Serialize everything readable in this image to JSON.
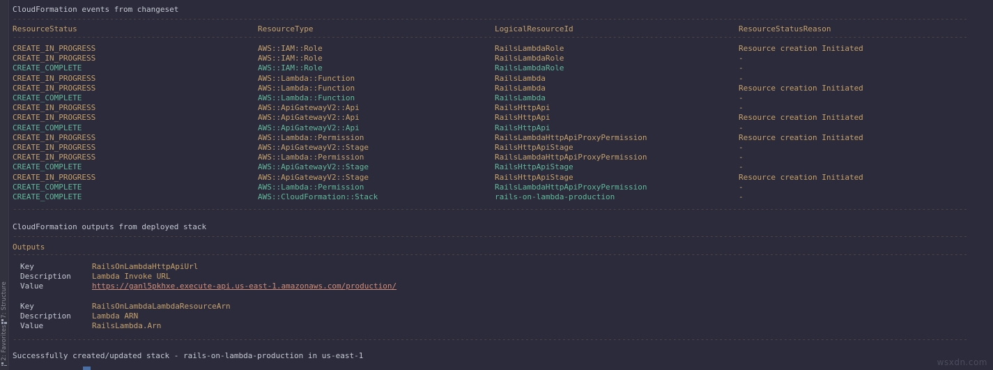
{
  "rail": {
    "structure_label": "7: Structure",
    "favorites_label": "2: Favorites"
  },
  "watermark": "wsxdn.com",
  "events_section": {
    "title": "CloudFormation events from changeset",
    "columns": [
      "ResourceStatus",
      "ResourceType",
      "LogicalResourceId",
      "ResourceStatusReason"
    ],
    "rows": [
      [
        "CREATE_IN_PROGRESS",
        "AWS::IAM::Role",
        "RailsLambdaRole",
        "Resource creation Initiated"
      ],
      [
        "CREATE_IN_PROGRESS",
        "AWS::IAM::Role",
        "RailsLambdaRole",
        "-"
      ],
      [
        "CREATE_COMPLETE",
        "AWS::IAM::Role",
        "RailsLambdaRole",
        "-"
      ],
      [
        "CREATE_IN_PROGRESS",
        "AWS::Lambda::Function",
        "RailsLambda",
        "-"
      ],
      [
        "CREATE_IN_PROGRESS",
        "AWS::Lambda::Function",
        "RailsLambda",
        "Resource creation Initiated"
      ],
      [
        "CREATE_COMPLETE",
        "AWS::Lambda::Function",
        "RailsLambda",
        "-"
      ],
      [
        "CREATE_IN_PROGRESS",
        "AWS::ApiGatewayV2::Api",
        "RailsHttpApi",
        "-"
      ],
      [
        "CREATE_IN_PROGRESS",
        "AWS::ApiGatewayV2::Api",
        "RailsHttpApi",
        "Resource creation Initiated"
      ],
      [
        "CREATE_COMPLETE",
        "AWS::ApiGatewayV2::Api",
        "RailsHttpApi",
        "-"
      ],
      [
        "CREATE_IN_PROGRESS",
        "AWS::Lambda::Permission",
        "RailsLambdaHttpApiProxyPermission",
        "Resource creation Initiated"
      ],
      [
        "CREATE_IN_PROGRESS",
        "AWS::ApiGatewayV2::Stage",
        "RailsHttpApiStage",
        "-"
      ],
      [
        "CREATE_IN_PROGRESS",
        "AWS::Lambda::Permission",
        "RailsLambdaHttpApiProxyPermission",
        "-"
      ],
      [
        "CREATE_COMPLETE",
        "AWS::ApiGatewayV2::Stage",
        "RailsHttpApiStage",
        "-"
      ],
      [
        "CREATE_IN_PROGRESS",
        "AWS::ApiGatewayV2::Stage",
        "RailsHttpApiStage",
        "Resource creation Initiated"
      ],
      [
        "CREATE_COMPLETE",
        "AWS::Lambda::Permission",
        "RailsLambdaHttpApiProxyPermission",
        "-"
      ],
      [
        "CREATE_COMPLETE",
        "AWS::CloudFormation::Stack",
        "rails-on-lambda-production",
        "-"
      ]
    ]
  },
  "outputs_section": {
    "title": "CloudFormation outputs from deployed stack",
    "heading": "Outputs",
    "field_labels": {
      "key": "Key",
      "description": "Description",
      "value": "Value"
    },
    "entries": [
      {
        "key": "RailsOnLambdaHttpApiUrl",
        "description": "Lambda Invoke URL",
        "value": "https://ganl5pkhxe.execute-api.us-east-1.amazonaws.com/production/",
        "value_is_link": true
      },
      {
        "key": "RailsOnLambdaLambdaResourceArn",
        "description": "Lambda ARN",
        "value": "RailsLambda.Arn",
        "value_is_link": false
      }
    ]
  },
  "status_line": "Successfully created/updated stack - rails-on-lambda-production in us-east-1",
  "colors": {
    "background": "#2b2b3b",
    "rail_background": "#32323e",
    "in_progress": "#c7a26b",
    "complete": "#62b99a",
    "link": "#d08f7d",
    "rule": "#8d7352",
    "plain_text": "#c6c8d4"
  }
}
